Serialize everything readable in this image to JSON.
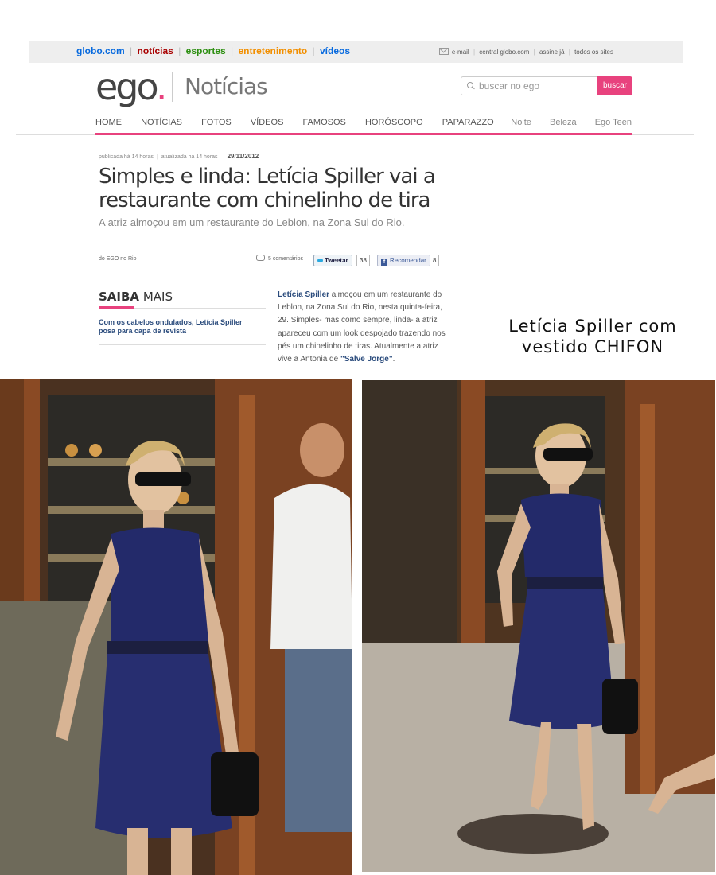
{
  "globobar": {
    "brand": "globo.com",
    "links": [
      "notícias",
      "esportes",
      "entretenimento",
      "vídeos"
    ],
    "right_links": [
      "e-mail",
      "central globo.com",
      "assine já",
      "todos os sites"
    ]
  },
  "header": {
    "logo": "ego",
    "section": "Notícias",
    "search_placeholder": "buscar no ego",
    "search_button": "buscar"
  },
  "nav": {
    "items": [
      "HOME",
      "NOTÍCIAS",
      "FOTOS",
      "VÍDEOS",
      "FAMOSOS",
      "HORÓSCOPO",
      "PAPARAZZO"
    ],
    "right_items": [
      "Noite",
      "Beleza",
      "Ego Teen"
    ]
  },
  "article": {
    "published": "publicada há 14 horas",
    "updated": "atualizada há 14 horas",
    "date": "29/11/2012",
    "headline": "Simples e linda: Letícia Spiller vai a restaurante com chinelinho de tira",
    "subtitle": "A atriz almoçou em um restaurante do Leblon, na Zona Sul do Rio.",
    "byline": "do EGO no Rio",
    "comments": "5 comentários",
    "tweet_label": "Tweetar",
    "tweet_count": "38",
    "fb_label": "Recomendar",
    "fb_count": "8",
    "body_name": "Letícia Spiller",
    "body_text": " almoçou em um restaurante do Leblon, na Zona Sul do Rio, nesta quinta-feira, 29. Simples- mas como sempre, linda- a atriz apareceu com um look despojado trazendo nos pés um chinelinho de tiras. Atualmente a atriz vive a Antonia de ",
    "body_show": "\"Salve Jorge\"",
    "body_end": "."
  },
  "saiba_mais": {
    "title_bold": "SAIBA",
    "title_rest": " MAIS",
    "link": "Com os cabelos ondulados, Letícia Spiller posa para capa de revista"
  },
  "caption": "Letícia Spiller com vestido CHIFON",
  "colors": {
    "accent_pink": "#e8427e",
    "link_blue": "#2a4b7c",
    "dress_navy": "#232a6a"
  }
}
